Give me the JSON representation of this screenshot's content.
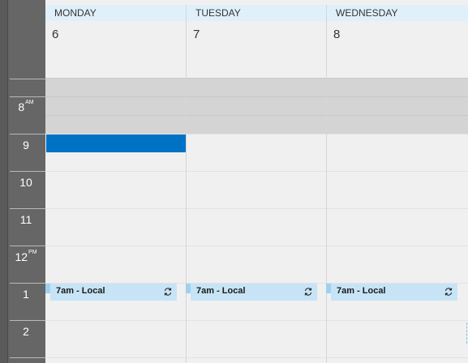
{
  "days": [
    {
      "name": "MONDAY",
      "date": "6"
    },
    {
      "name": "TUESDAY",
      "date": "7"
    },
    {
      "name": "WEDNESDAY",
      "date": "8"
    }
  ],
  "hours": [
    {
      "label": "8",
      "period": "AM"
    },
    {
      "label": "9",
      "period": ""
    },
    {
      "label": "10",
      "period": ""
    },
    {
      "label": "11",
      "period": ""
    },
    {
      "label": "12",
      "period": "PM"
    },
    {
      "label": "1",
      "period": ""
    },
    {
      "label": "2",
      "period": ""
    }
  ],
  "events": [
    {
      "title": "7am - Local",
      "icon": "recurring-icon"
    },
    {
      "title": "7am - Local",
      "icon": "recurring-icon"
    },
    {
      "title": "7am - Local",
      "icon": "recurring-icon"
    }
  ],
  "colors": {
    "header_bg": "#dff0fb",
    "selection": "#0072c6",
    "event_bg": "#c7e4f7",
    "time_column": "#666666"
  }
}
